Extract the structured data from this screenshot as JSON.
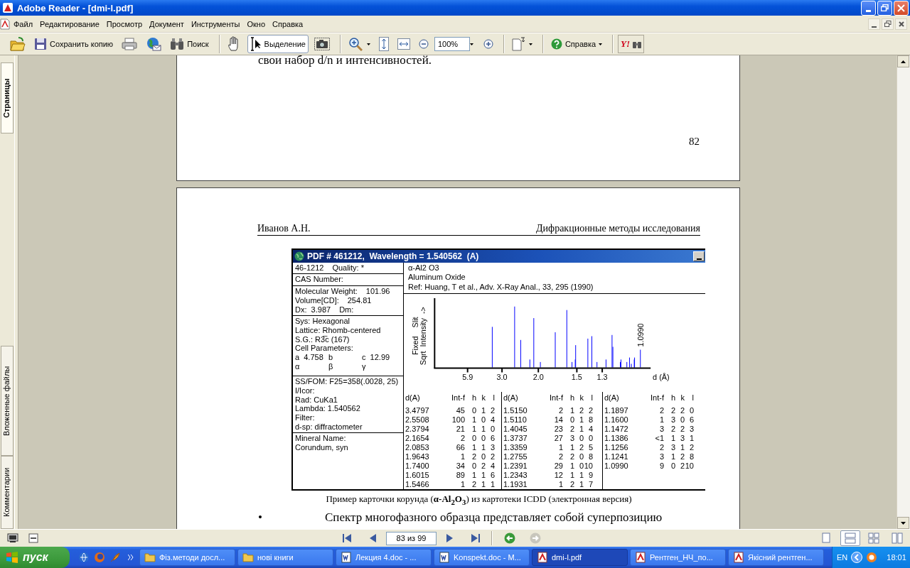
{
  "window": {
    "title": "Adobe Reader - [dmi-l.pdf]"
  },
  "menu": [
    "Файл",
    "Редактирование",
    "Просмотр",
    "Документ",
    "Инструменты",
    "Окно",
    "Справка"
  ],
  "toolbar": {
    "save_copy": "Сохранить копию",
    "search": "Поиск",
    "select": {
      "label": "Выделение",
      "selected": true
    },
    "zoom": "100%",
    "help": "Справка",
    "yahoo": "Y!"
  },
  "side_tabs": [
    {
      "label": "Страницы",
      "selected": true
    },
    {
      "label": "Вложенные файлы",
      "selected": false
    },
    {
      "label": "Комментарии",
      "selected": false
    }
  ],
  "page_prev": {
    "text": "свои набор d/n и интенсивностей.",
    "page_number": "82"
  },
  "page": {
    "header_left": "Иванов А.Н.",
    "header_right": "Дифракционные методы исследования",
    "card": {
      "title": "PDF # 461212,  Wavelength = 1.540562  (A)",
      "left_sections": [
        [
          [
            "46-1212",
            "Quality: *"
          ]
        ],
        [
          [
            "CAS Number:"
          ]
        ],
        [
          [
            "Molecular Weight:",
            "101.96"
          ],
          [
            "Volume[CD]:",
            "254.81"
          ],
          [
            "Dx:  3.987",
            "Dm:"
          ]
        ],
        [
          [
            "Sys: Hexagonal"
          ],
          [
            "Lattice: Rhomb-centered"
          ],
          [
            "S.G.: R3̅c (167)"
          ],
          [
            "Cell Parameters:"
          ],
          [
            "a  4.758",
            "b",
            "c  12.99"
          ],
          [
            "α",
            "β",
            "γ"
          ]
        ],
        [
          [
            "SS/FOM: F25=358(.0028, 25)"
          ],
          [
            "I/Icor:"
          ],
          [
            "Rad: CuKa1"
          ],
          [
            "Lambda: 1.540562"
          ],
          [
            "Filter:"
          ],
          [
            "d-sp: diffractometer"
          ]
        ],
        [
          [
            "Mineral Name:"
          ],
          [
            "Corundum, syn"
          ]
        ]
      ],
      "info_lines": [
        "α-Al2 O3",
        "Aluminum Oxide",
        "Ref: Huang, T et al., Adv. X-Ray Anal., 33, 295 (1990)"
      ],
      "chart": {
        "y_label": [
          "Fixed    Slit",
          "Sqrt  Intensity  ->"
        ],
        "x_ticks": [
          "5.9",
          "3.0",
          "2.0",
          "1.5",
          "1.3"
        ],
        "x_label": "d (Å)",
        "peak_label": "1.0990"
      },
      "table": {
        "blocks": [
          {
            "columns": [
              "d(A)",
              "Int-f",
              "h",
              "k",
              "l"
            ],
            "rows": [
              [
                "3.4797",
                "45",
                "0",
                "1",
                "2"
              ],
              [
                "2.5508",
                "100",
                "1",
                "0",
                "4"
              ],
              [
                "2.3794",
                "21",
                "1",
                "1",
                "0"
              ],
              [
                "2.1654",
                "2",
                "0",
                "0",
                "6"
              ],
              [
                "2.0853",
                "66",
                "1",
                "1",
                "3"
              ],
              [
                "1.9643",
                "1",
                "2",
                "0",
                "2"
              ],
              [
                "1.7400",
                "34",
                "0",
                "2",
                "4"
              ],
              [
                "1.6015",
                "89",
                "1",
                "1",
                "6"
              ],
              [
                "1.5466",
                "1",
                "2",
                "1",
                "1"
              ]
            ]
          },
          {
            "columns": [
              "d(A)",
              "Int-f",
              "h",
              "k",
              "l"
            ],
            "rows": [
              [
                "1.5150",
                "2",
                "1",
                "2",
                "2"
              ],
              [
                "1.5110",
                "14",
                "0",
                "1",
                "8"
              ],
              [
                "1.4045",
                "23",
                "2",
                "1",
                "4"
              ],
              [
                "1.3737",
                "27",
                "3",
                "0",
                "0"
              ],
              [
                "1.3359",
                "1",
                "1",
                "2",
                "5"
              ],
              [
                "1.2755",
                "2",
                "2",
                "0",
                "8"
              ],
              [
                "1.2391",
                "29",
                "1",
                "0",
                "10"
              ],
              [
                "1.2343",
                "12",
                "1",
                "1",
                "9"
              ],
              [
                "1.1931",
                "1",
                "2",
                "1",
                "7"
              ]
            ]
          },
          {
            "columns": [
              "d(A)",
              "Int-f",
              "h",
              "k",
              "l"
            ],
            "rows": [
              [
                "1.1897",
                "2",
                "2",
                "2",
                "0"
              ],
              [
                "1.1600",
                "1",
                "3",
                "0",
                "6"
              ],
              [
                "1.1472",
                "3",
                "2",
                "2",
                "3"
              ],
              [
                "1.1386",
                "<1",
                "1",
                "3",
                "1"
              ],
              [
                "1.1256",
                "2",
                "3",
                "1",
                "2"
              ],
              [
                "1.1241",
                "3",
                "1",
                "2",
                "8"
              ],
              [
                "1.0990",
                "9",
                "0",
                "2",
                "10"
              ]
            ]
          }
        ]
      }
    },
    "caption": "Пример карточки корунда (**α-Al$_{2}$O$_{3}$**) из картотеки ICDD (электронная версия)",
    "bullet": "•",
    "paragraph": "Спектр многофазного образца представляет собой суперпозицию"
  },
  "status_bar": {
    "page_field": "83 из 99",
    "view_modes": [
      {
        "selected": false
      },
      {
        "selected": true
      },
      {
        "selected": false
      },
      {
        "selected": false
      }
    ]
  },
  "taskbar": {
    "start": "пуск",
    "tasks": [
      {
        "label": "Фіз.методи досл...",
        "kind": "folder",
        "selected": false
      },
      {
        "label": "нові книги",
        "kind": "folder",
        "selected": false
      },
      {
        "label": "Лекция 4.doc - ...",
        "kind": "word",
        "selected": false
      },
      {
        "label": "Konspekt.doc - M...",
        "kind": "word",
        "selected": false
      },
      {
        "label": "dmi-l.pdf",
        "kind": "pdf",
        "selected": true
      },
      {
        "label": "Рентген_НЧ_по...",
        "kind": "pdf",
        "selected": false
      },
      {
        "label": "Якісний рентген...",
        "kind": "pdf",
        "selected": false
      }
    ],
    "language": "EN",
    "clock": "18:01"
  }
}
